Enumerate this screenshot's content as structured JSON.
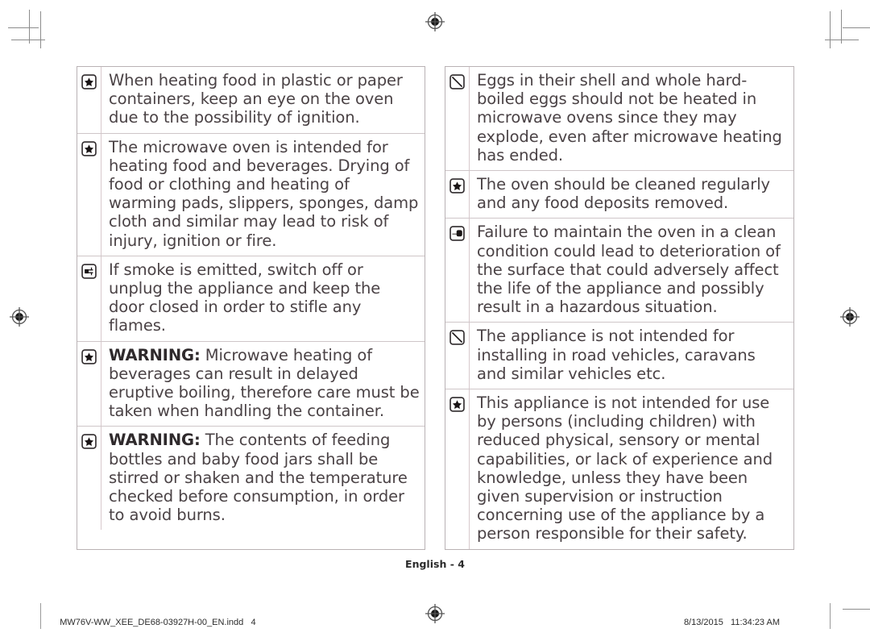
{
  "document": {
    "page_label": "English - 4",
    "footer_filename": "MW76V-WW_XEE_DE68-03927H-00_EN.indd",
    "footer_page_number": "4",
    "footer_date": "8/13/2015",
    "footer_time": "11:34:23 AM"
  },
  "colors": {
    "text": "#4a4245",
    "border": "#b9b2b4",
    "row_divider": "#cfc6c8",
    "icon_divider": "#d8c9cd",
    "crop_mark": "#8c8c8c"
  },
  "left_column": {
    "rows": [
      {
        "icon": "star-icon",
        "lead": "",
        "text": "When heating food in plastic or paper containers, keep an eye on the oven due to the possibility of ignition."
      },
      {
        "icon": "star-icon",
        "lead": "",
        "text": "The microwave oven is intended for heating food and beverages. Drying of food or clothing and heating of warming pads, slippers, sponges, damp cloth and similar may lead to risk of injury, ignition or fire."
      },
      {
        "icon": "unplug-icon",
        "lead": "",
        "text": "If smoke is emitted, switch off or unplug the appliance and keep the door closed in order to stifle any flames."
      },
      {
        "icon": "star-icon",
        "lead": "WARNING:",
        "text": " Microwave heating of beverages can result in delayed eruptive boiling, therefore care must be taken when handling the container."
      },
      {
        "icon": "star-icon",
        "lead": "WARNING:",
        "text": " The contents of feeding bottles and baby food jars shall be stirred or shaken and the temperature checked before consumption, in order to avoid burns."
      }
    ]
  },
  "right_column": {
    "rows": [
      {
        "icon": "prohibited-icon",
        "lead": "",
        "text": "Eggs in their shell and whole hard-boiled eggs should not be heated in microwave ovens since they may explode, even after microwave heating has ended."
      },
      {
        "icon": "star-icon",
        "lead": "",
        "text": "The oven should be cleaned regularly and any food deposits removed."
      },
      {
        "icon": "pointing-hand-icon",
        "lead": "",
        "text": "Failure to maintain the oven in a clean condition could lead to deterioration of the surface that could adversely affect the life of the appliance and possibly result in a hazardous situation."
      },
      {
        "icon": "prohibited-icon",
        "lead": "",
        "text": "The appliance is not intended for installing in road vehicles, caravans and similar vehicles etc."
      },
      {
        "icon": "star-icon",
        "lead": "",
        "text": "This appliance is not intended for use by persons (including children) with reduced physical, sensory or mental capabilities, or lack of experience and knowledge, unless they have been given supervision or instruction concerning use of the appliance by a person responsible for their safety."
      }
    ]
  }
}
